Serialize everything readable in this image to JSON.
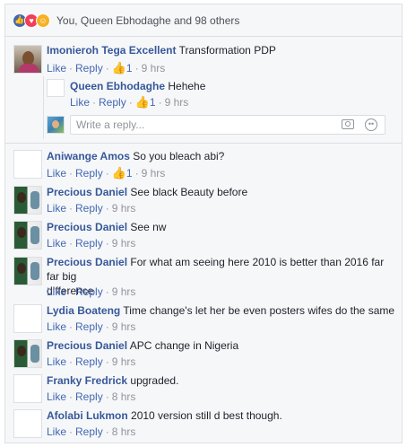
{
  "reactions": {
    "icons": [
      "like-icon",
      "love-icon",
      "haha-icon"
    ],
    "summary": "You, Queen Ebhodaghe and 98 others"
  },
  "actions": {
    "like": "Like",
    "reply": "Reply"
  },
  "reply_box": {
    "placeholder": "Write a reply..."
  },
  "comments": [
    {
      "name": "Imonieroh Tega Excellent",
      "text": "Transformation PDP",
      "likes": "1",
      "time": "9 hrs",
      "avatar": "photo"
    },
    {
      "name": "Queen Ebhodaghe",
      "text": "Hehehe",
      "likes": "1",
      "time": "9 hrs",
      "avatar": "blank",
      "reply": true
    },
    {
      "name": "Aniwange Amos",
      "text": "So you bleach abi?",
      "likes": "1",
      "time": "9 hrs",
      "avatar": "blank"
    },
    {
      "name": "Precious Daniel",
      "text": "See black Beauty before",
      "time": "9 hrs",
      "avatar": "photo"
    },
    {
      "name": "Precious Daniel",
      "text": "See nw",
      "time": "9 hrs",
      "avatar": "photo"
    },
    {
      "name": "Precious Daniel",
      "text_line1": "For what am seeing here 2010 is better than 2016 far far big",
      "text_line2": "difference",
      "time": "9 hrs",
      "avatar": "photo"
    },
    {
      "name": "Lydia Boateng",
      "text": "Time change's let her be even posters wifes do the same",
      "time": "9 hrs",
      "avatar": "blank"
    },
    {
      "name": "Precious Daniel",
      "text": "APC change in Nigeria",
      "time": "9 hrs",
      "avatar": "photo"
    },
    {
      "name": "Franky Fredrick",
      "text": "upgraded.",
      "time": "8 hrs",
      "avatar": "blank"
    },
    {
      "name": "Afolabi Lukmon",
      "text": "2010 version still d best though.",
      "time": "8 hrs",
      "avatar": "blank"
    }
  ],
  "colors": {
    "link": "#365899",
    "action": "#4267b2",
    "meta": "#90949c",
    "panel": "#f6f7f9"
  }
}
